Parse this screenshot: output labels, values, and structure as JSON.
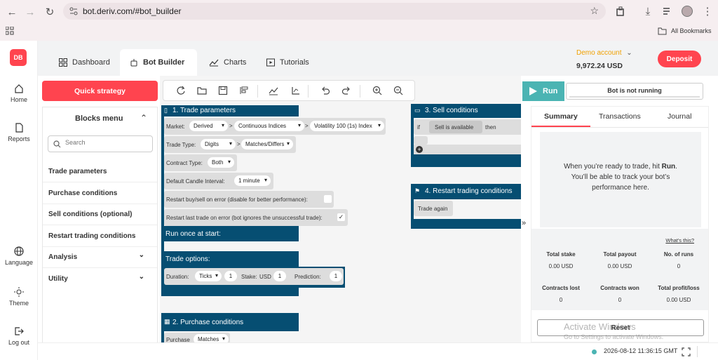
{
  "browser": {
    "url": "bot.deriv.com/#bot_builder",
    "bookmarks_label": "All Bookmarks"
  },
  "brand": {
    "logo_text": "DB",
    "accent": "#ff444f"
  },
  "sidebar": {
    "home": "Home",
    "reports": "Reports",
    "language": "Language",
    "theme": "Theme",
    "logout": "Log out"
  },
  "tabs": {
    "dashboard": "Dashboard",
    "bot_builder": "Bot Builder",
    "charts": "Charts",
    "tutorials": "Tutorials"
  },
  "account": {
    "type": "Demo account",
    "balance": "9,972.24 USD",
    "deposit": "Deposit"
  },
  "left": {
    "quick_strategy": "Quick strategy",
    "blocks_menu": "Blocks menu",
    "search_placeholder": "Search",
    "items": [
      "Trade parameters",
      "Purchase conditions",
      "Sell conditions (optional)",
      "Restart trading conditions",
      "Analysis",
      "Utility"
    ]
  },
  "blocks": {
    "trade_params": {
      "title": "1. Trade parameters",
      "market_label": "Market:",
      "market": "Derived",
      "submarket": "Continuous Indices",
      "symbol": "Volatility 100 (1s) Index",
      "trade_type_label": "Trade Type:",
      "trade_type": "Digits",
      "trade_subtype": "Matches/Differs",
      "contract_type_label": "Contract Type:",
      "contract_type": "Both",
      "candle_label": "Default Candle Interval:",
      "candle": "1 minute",
      "restart_buysell": "Restart buy/sell on error (disable for better performance):",
      "restart_last": "Restart last trade on error (bot ignores the unsuccessful trade):",
      "check": "✓",
      "run_once": "Run once at start:",
      "trade_options": "Trade options:",
      "duration_label": "Duration:",
      "duration_unit": "Ticks",
      "duration_value": "1",
      "stake_label": "Stake:",
      "stake_currency": "USD",
      "stake_value": "1",
      "prediction_label": "Prediction:",
      "prediction_value": "1"
    },
    "purchase": {
      "title": "2. Purchase conditions",
      "label": "Purchase",
      "value": "Matches"
    },
    "sell": {
      "title": "3. Sell conditions",
      "if": "if",
      "sell_available": "Sell is available",
      "then": "then"
    },
    "restart": {
      "title": "4. Restart trading conditions",
      "trade_again": "Trade again"
    }
  },
  "run": {
    "label": "Run",
    "status": "Bot is not running",
    "expand": "»"
  },
  "panel": {
    "tabs": [
      "Summary",
      "Transactions",
      "Journal"
    ],
    "msg_prefix": "When you’re ready to trade, hit ",
    "msg_bold": "Run",
    "msg_suffix": ".",
    "msg_line2": "You’ll be able to track your bot’s",
    "msg_line3": "performance here.",
    "whats_this": "What's this?",
    "stats": [
      {
        "label": "Total stake",
        "value": "0.00 USD"
      },
      {
        "label": "Total payout",
        "value": "0.00 USD"
      },
      {
        "label": "No. of runs",
        "value": "0"
      },
      {
        "label": "Contracts lost",
        "value": "0"
      },
      {
        "label": "Contracts won",
        "value": "0"
      },
      {
        "label": "Total profit/loss",
        "value": "0.00 USD"
      }
    ],
    "reset": "Reset"
  },
  "footer": {
    "timestamp": "2026-08-12 11:36:15 GMT",
    "watermark1": "Activate Windows",
    "watermark2": "Go to Settings to activate Windows."
  }
}
